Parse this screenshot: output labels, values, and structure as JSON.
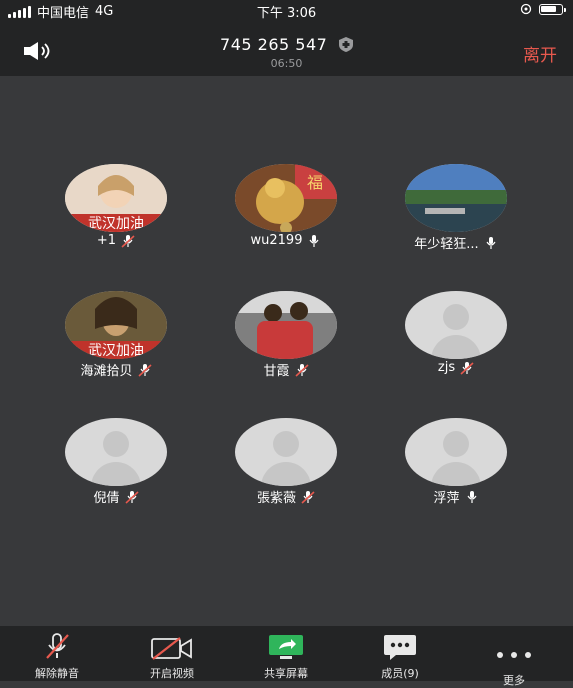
{
  "status_bar": {
    "carrier": "中国电信",
    "network": "4G",
    "time": "下午 3:06",
    "battery_level": 0.8
  },
  "header": {
    "meeting_id": "745 265 547",
    "elapsed": "06:50",
    "leave_label": "离开"
  },
  "participants": [
    {
      "name": "+1",
      "mic": "muted",
      "avatar": "photo",
      "avatar_colors": [
        "#e8d8c8",
        "#c0332b"
      ],
      "banner": "武汉加油"
    },
    {
      "name": "wu2199",
      "mic": "on",
      "avatar": "photo",
      "avatar_colors": [
        "#b89048",
        "#c94040"
      ],
      "banner": "福"
    },
    {
      "name": "年少轻狂...",
      "mic": "on",
      "avatar": "photo",
      "avatar_colors": [
        "#4f7fbf",
        "#3f6a3a"
      ]
    },
    {
      "name": "海滩拾贝",
      "mic": "muted",
      "avatar": "photo",
      "avatar_colors": [
        "#6a5a3a",
        "#c0332b"
      ],
      "banner": "武汉加油"
    },
    {
      "name": "甘霞",
      "mic": "muted",
      "avatar": "photo",
      "avatar_colors": [
        "#7f7f7f",
        "#c83a3a"
      ]
    },
    {
      "name": "zjs",
      "mic": "muted",
      "avatar": "default"
    },
    {
      "name": "倪倩",
      "mic": "muted",
      "avatar": "default"
    },
    {
      "name": "張紫薇",
      "mic": "muted",
      "avatar": "default"
    },
    {
      "name": "浮萍",
      "mic": "on",
      "avatar": "default"
    }
  ],
  "toolbar": {
    "unmute": "解除静音",
    "start_video": "开启视频",
    "share_screen": "共享屏幕",
    "members": "成员(9)",
    "more": "更多"
  },
  "colors": {
    "bg": "#38393b",
    "bar": "#232425",
    "leave": "#e7594e",
    "accent": "#2fb55b"
  }
}
